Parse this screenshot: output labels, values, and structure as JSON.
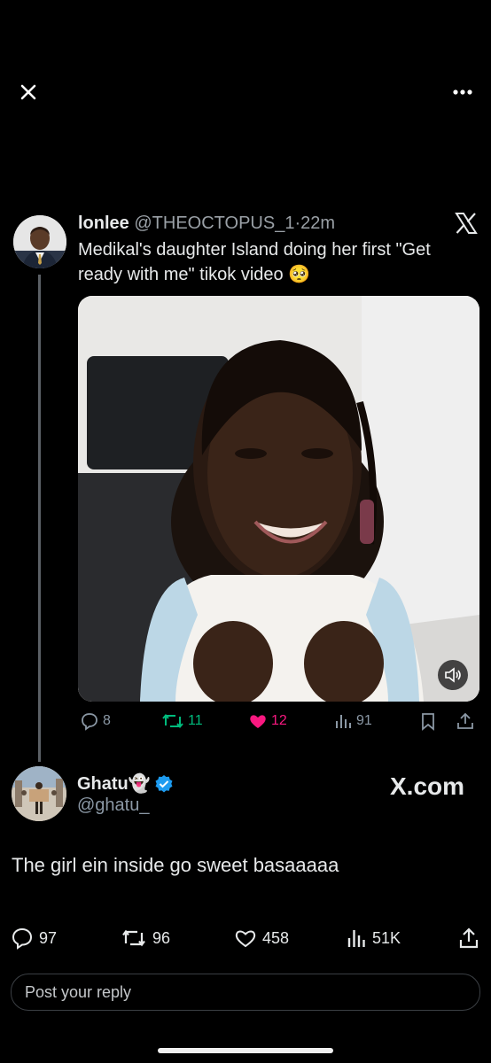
{
  "top_bar": {
    "close_icon": "close-icon",
    "more_icon": "more-icon"
  },
  "embedded_tweet": {
    "display_name": "lonlee",
    "handle": "@THEOCTOPUS_1",
    "separator": "·",
    "time": "22m",
    "text": "Medikal's daughter Island doing her first \"Get ready with me\"  tikok video 🥺",
    "stats": {
      "replies": "8",
      "reposts": "11",
      "likes": "12",
      "views": "91"
    },
    "colors": {
      "repost": "#00ba7c",
      "like": "#f91880",
      "muted": "#8b98a5"
    }
  },
  "main_tweet": {
    "display_name": "Ghatu👻",
    "handle": "@ghatu_",
    "verified": true,
    "watermark": "X.com",
    "text": "The girl ein inside go sweet basaaaaa",
    "stats": {
      "replies": "97",
      "reposts": "96",
      "likes": "458",
      "views": "51K"
    }
  },
  "reply": {
    "placeholder": "Post your reply"
  },
  "colors": {
    "background": "#000000",
    "verified": "#1d9bf0",
    "text": "#e7e9ea"
  }
}
